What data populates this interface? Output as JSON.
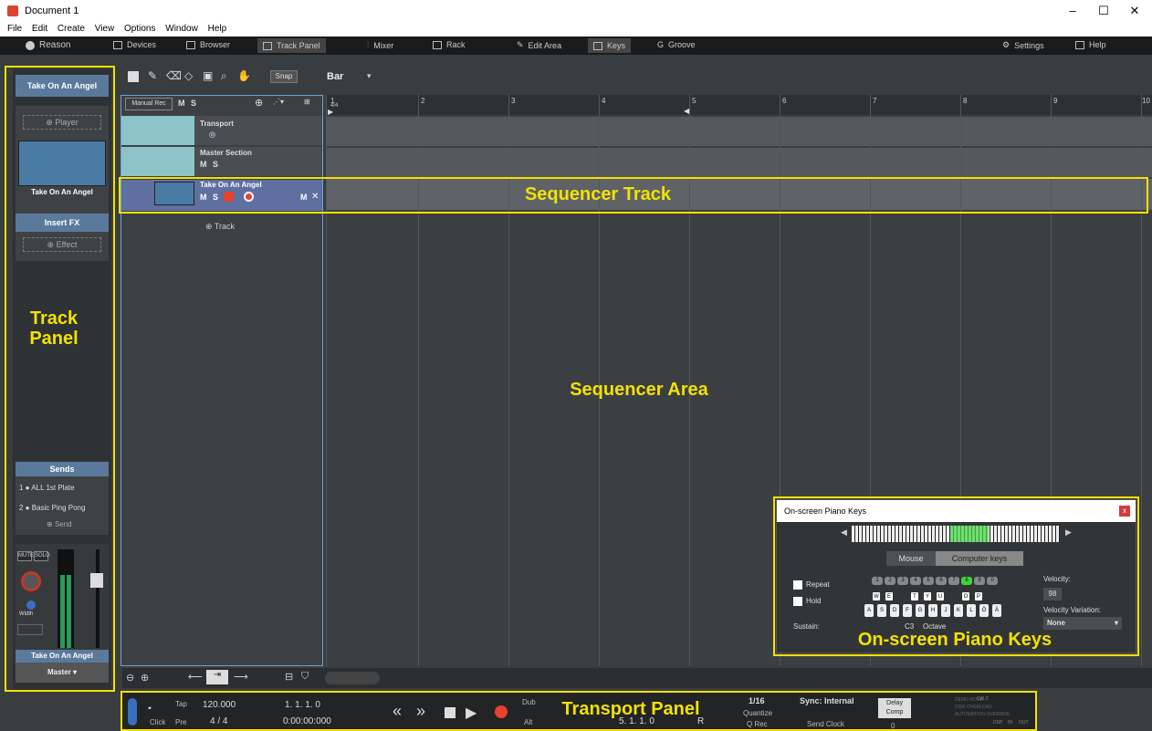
{
  "window": {
    "title": "Document 1",
    "min": "–",
    "max": "☐",
    "close": "✕"
  },
  "menu": [
    "File",
    "Edit",
    "Create",
    "View",
    "Options",
    "Window",
    "Help"
  ],
  "nav": {
    "brand": "Reason",
    "items": [
      "Devices",
      "Browser",
      "Track Panel",
      "Mixer",
      "Rack",
      "Edit Area",
      "Keys",
      "Groove"
    ],
    "active": [
      "Track Panel",
      "Keys"
    ],
    "settings": "Settings",
    "help": "Help"
  },
  "trackpanel": {
    "device_header": "Take On An Angel",
    "player_btn": "Player",
    "device_name": "Take On An Angel",
    "insert_fx": "Insert FX",
    "effect_btn": "Effect",
    "sends_header": "Sends",
    "sends": [
      {
        "num": "1",
        "label": "ALL 1st Plate"
      },
      {
        "num": "2",
        "label": "Basic Ping Pong"
      }
    ],
    "send_btn": "Send",
    "mute": "MUTE",
    "solo": "SOLO",
    "width_label": "Width",
    "channel_name": "Take On An Angel",
    "output": "Master"
  },
  "toolbar": {
    "snap": "Snap",
    "grid": "Bar"
  },
  "tracklist": {
    "manual_rec": "Manual Rec",
    "m": "M",
    "s": "S",
    "tracks": [
      {
        "name": "Transport"
      },
      {
        "name": "Master Section",
        "m": "M",
        "s": "S"
      },
      {
        "name": "Take On An Angel",
        "m": "M",
        "s": "S",
        "m2": "M",
        "x": "✕"
      }
    ],
    "add_track": "Track"
  },
  "sequencer": {
    "bars": [
      "1",
      "2",
      "3",
      "4",
      "5",
      "6",
      "7",
      "8",
      "9",
      "10"
    ],
    "signature": "4/4"
  },
  "transport": {
    "tap": "Tap",
    "click": "Click",
    "pre": "Pre",
    "tempo": "120.000",
    "signature": "4 / 4",
    "position": "1. 1. 1. 0",
    "time": "0:00:00:000",
    "dub": "Dub",
    "alt": "Alt",
    "loop_end": "5. 1. 1. 0",
    "r": "R",
    "quantize_value": "1/16",
    "quantize": "Quantize",
    "qrec": "Q Rec",
    "sync": "Sync: Internal",
    "send_clock": "Send Clock",
    "delay_comp": "Delay Comp",
    "delay_val": "0",
    "calc": "CALC",
    "status_labels": [
      "DEMO MODE",
      "DISK OVERLOAD",
      "AUTOMATION OVERRIDE"
    ],
    "dsp": "DSP",
    "in": "IN",
    "out": "OUT"
  },
  "piano": {
    "title": "On-screen Piano Keys",
    "mouse": "Mouse",
    "computer_keys": "Computer keys",
    "repeat": "Repeat",
    "hold": "Hold",
    "sustain": "Sustain:",
    "velocity": "Velocity:",
    "velocity_value": "98",
    "velocity_variation": "Velocity Variation:",
    "variation_value": "None",
    "octave_label": "C3",
    "octave": "Octave",
    "numbers": [
      "1",
      "2",
      "3",
      "4",
      "5",
      "6",
      "7",
      "8",
      "9",
      "0"
    ],
    "black_keys": [
      "W",
      "E",
      "",
      "T",
      "Y",
      "U",
      "",
      "O",
      "P"
    ],
    "white_keys": [
      "A",
      "S",
      "D",
      "F",
      "G",
      "H",
      "J",
      "K",
      "L",
      "Ö",
      "Ä"
    ]
  },
  "annotations": {
    "track_panel": "Track Panel",
    "sequencer_track": "Sequencer Track",
    "sequencer_area": "Sequencer Area",
    "piano_keys": "On-screen Piano Keys",
    "transport_panel": "Transport Panel"
  },
  "colors": {
    "highlight": "#f2e200",
    "accent_blue": "#5b7a9b",
    "record": "#e8412c",
    "active_green": "#3fd43f"
  }
}
